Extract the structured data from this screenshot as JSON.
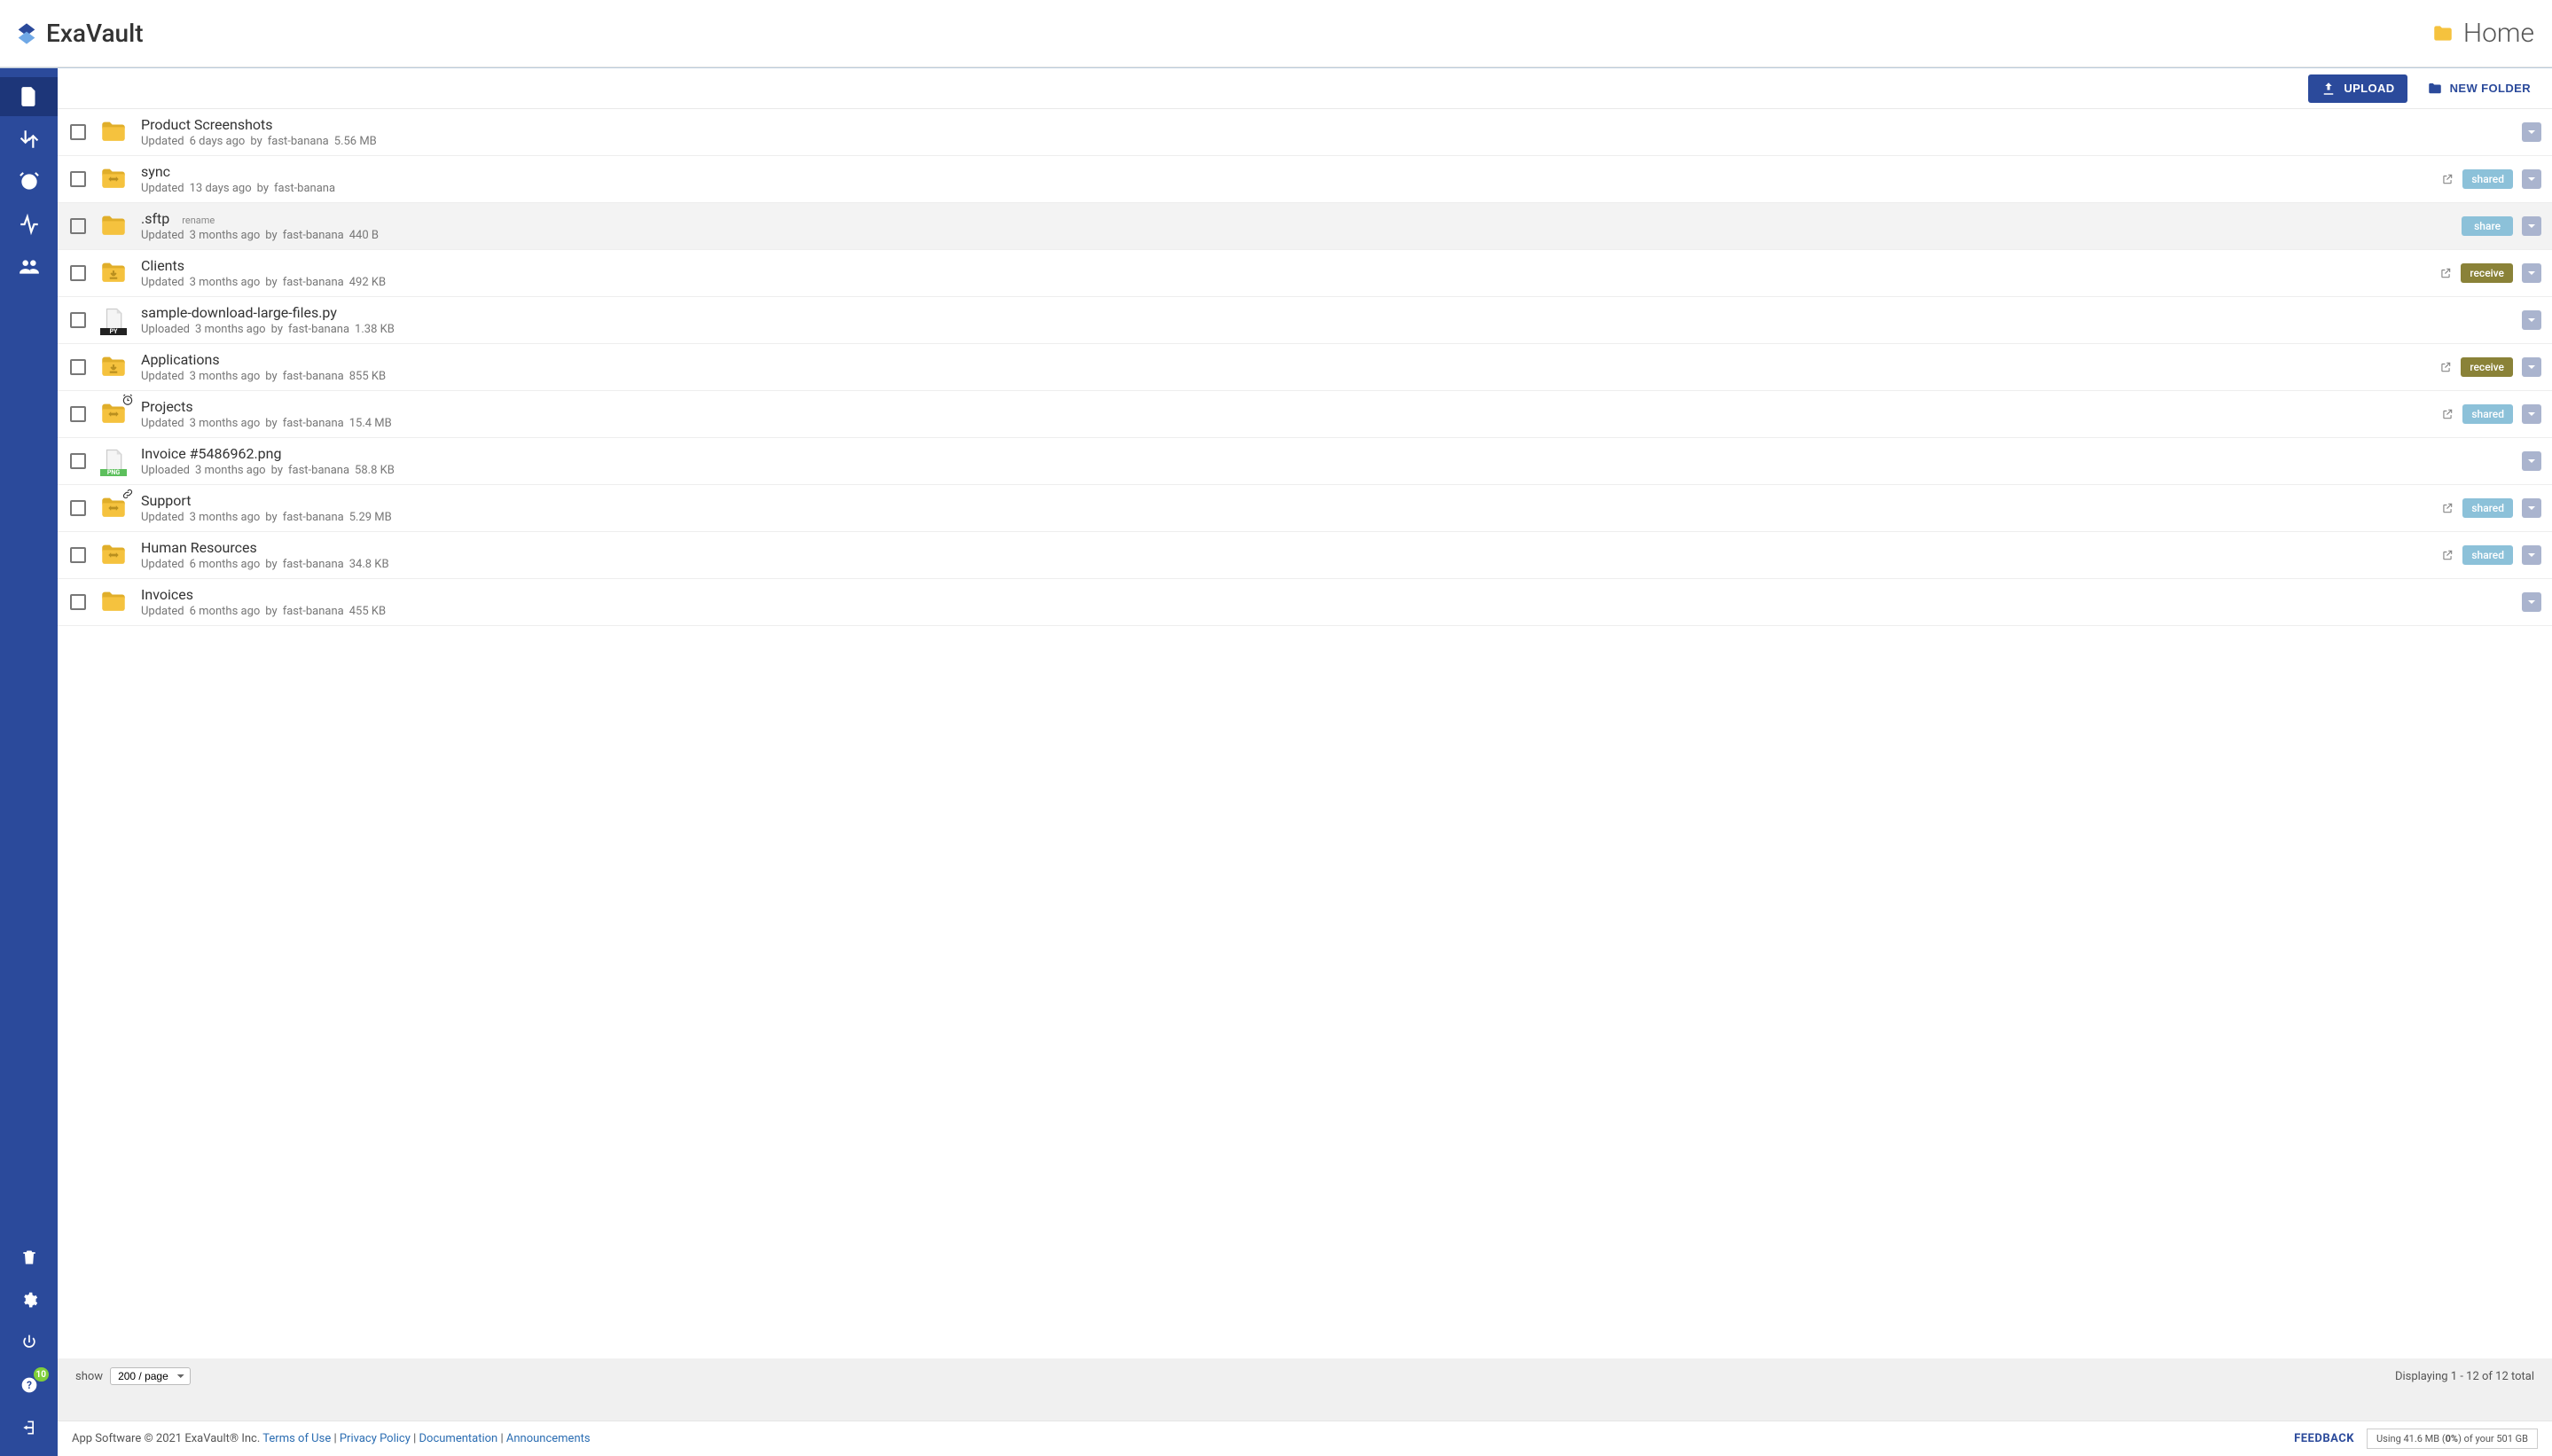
{
  "brand": {
    "name": "ExaVault"
  },
  "breadcrumb": {
    "label": "Home"
  },
  "toolbar": {
    "upload": "Upload",
    "new_folder": "New Folder"
  },
  "sidebar": {
    "top": [
      {
        "name": "files",
        "active": true
      },
      {
        "name": "transfers"
      },
      {
        "name": "alarms"
      },
      {
        "name": "activity"
      },
      {
        "name": "users"
      }
    ],
    "bottom": [
      {
        "name": "trash"
      },
      {
        "name": "settings"
      },
      {
        "name": "power"
      },
      {
        "name": "help",
        "badge": "10"
      },
      {
        "name": "logout"
      }
    ]
  },
  "files": [
    {
      "name": "Product Screenshots",
      "icon": "folder",
      "verb": "Updated",
      "age": "6 days ago",
      "by": "fast-banana",
      "size": "5.56 MB"
    },
    {
      "name": "sync",
      "icon": "folder-sync",
      "verb": "Updated",
      "age": "13 days ago",
      "by": "fast-banana",
      "size": "",
      "external": true,
      "badge": "shared"
    },
    {
      "name": ".sftp",
      "icon": "folder",
      "rename_hint": "rename",
      "verb": "Updated",
      "age": "3 months ago",
      "by": "fast-banana",
      "size": "440 B",
      "hovered": true,
      "badge": "share"
    },
    {
      "name": "Clients",
      "icon": "folder-receive",
      "verb": "Updated",
      "age": "3 months ago",
      "by": "fast-banana",
      "size": "492 KB",
      "external": true,
      "badge": "receive"
    },
    {
      "name": "sample-download-large-files.py",
      "icon": "file-py",
      "verb": "Uploaded",
      "age": "3 months ago",
      "by": "fast-banana",
      "size": "1.38 KB"
    },
    {
      "name": "Applications",
      "icon": "folder-receive",
      "verb": "Updated",
      "age": "3 months ago",
      "by": "fast-banana",
      "size": "855 KB",
      "external": true,
      "badge": "receive"
    },
    {
      "name": "Projects",
      "icon": "folder-sync",
      "overlay": "alarm",
      "verb": "Updated",
      "age": "3 months ago",
      "by": "fast-banana",
      "size": "15.4 MB",
      "external": true,
      "badge": "shared"
    },
    {
      "name": "Invoice #5486962.png",
      "icon": "file-png",
      "verb": "Uploaded",
      "age": "3 months ago",
      "by": "fast-banana",
      "size": "58.8 KB"
    },
    {
      "name": "Support",
      "icon": "folder-sync",
      "overlay": "link",
      "verb": "Updated",
      "age": "3 months ago",
      "by": "fast-banana",
      "size": "5.29 MB",
      "external": true,
      "badge": "shared"
    },
    {
      "name": "Human Resources",
      "icon": "folder-sync",
      "verb": "Updated",
      "age": "6 months ago",
      "by": "fast-banana",
      "size": "34.8 KB",
      "external": true,
      "badge": "shared"
    },
    {
      "name": "Invoices",
      "icon": "folder",
      "verb": "Updated",
      "age": "6 months ago",
      "by": "fast-banana",
      "size": "455 KB"
    }
  ],
  "labels": {
    "by": "by",
    "show": "show"
  },
  "pager": {
    "page_size": "200 / page",
    "summary": "Displaying 1 - 12 of 12 total"
  },
  "footer": {
    "copyright": "App Software © 2021 ExaVault® Inc.",
    "links": {
      "terms": "Terms of Use",
      "privacy": "Privacy Policy",
      "docs": "Documentation",
      "announce": "Announcements"
    },
    "feedback": "FEEDBACK",
    "storage_prefix": "Using 41.6 MB (",
    "storage_percent": "0%",
    "storage_suffix": ") of your 501 GB"
  }
}
